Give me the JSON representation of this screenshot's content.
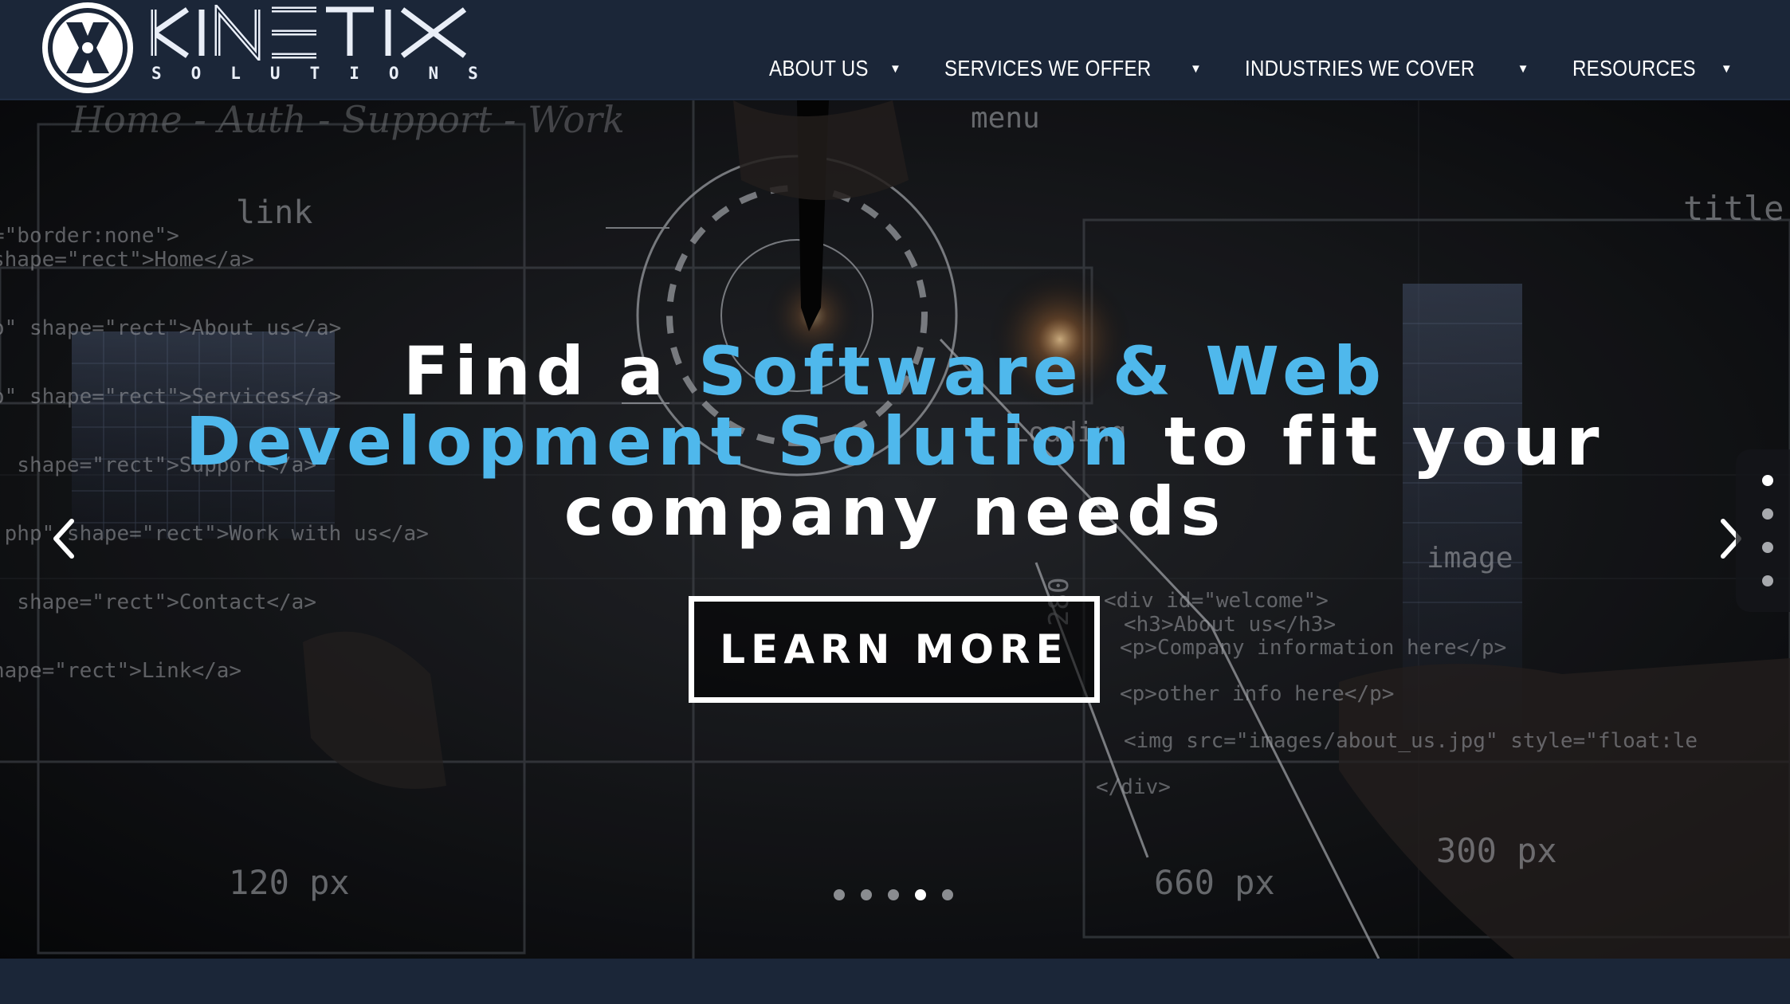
{
  "brand": {
    "wordmark": "KINETIX",
    "tagline": "SOLUTIONS",
    "badge_letter": "X",
    "colors": {
      "navy": "#1b2638",
      "accent": "#4fb8ec",
      "white": "#ffffff"
    }
  },
  "nav": {
    "items": [
      {
        "label": "ABOUT US",
        "caret": "▼"
      },
      {
        "label": "SERVICES WE OFFER",
        "caret": "▼"
      },
      {
        "label": "INDUSTRIES WE COVER",
        "caret": "▼"
      },
      {
        "label": "RESOURCES",
        "caret": "▼"
      }
    ]
  },
  "hero": {
    "headline": {
      "line1_plain": "Find a ",
      "line1_accent": "Software & Web",
      "line2_accent": "Development Solution",
      "line2_plain": " to fit your",
      "line3_plain": "company needs"
    },
    "cta_label": "LEARN MORE",
    "prev_icon": "chevron-left",
    "next_icon": "chevron-right",
    "slides_total": 5,
    "active_slide": 4,
    "background_text": {
      "code_lines": [
        "=\"border:none\">",
        "shape=\"rect\">Home</a>",
        "o\" shape=\"rect\">About us</a>",
        "o\" shape=\"rect\">Services</a>",
        "' shape=\"rect\">Support</a>",
        ".php\" shape=\"rect\">Work with us</a>",
        "' shape=\"rect\">Contact</a>",
        "nape=\"rect\">Link</a>"
      ],
      "code_right": [
        "<div id=\"welcome\">",
        "<h3>About us</h3>",
        "<p>Company information here</p>",
        "<p>other info here</p>",
        "<img src=\"images/about_us.jpg\" style=\"float:le",
        "</div>"
      ],
      "labels": {
        "menu": "menu",
        "link": "link",
        "title": "title",
        "image": "image",
        "loading": "Loading",
        "dim_120": "120 px",
        "dim_660": "660 px",
        "dim_300": "300 px",
        "dim_280": "280",
        "handwriting": "Home - Auth - Support - Work"
      }
    }
  }
}
